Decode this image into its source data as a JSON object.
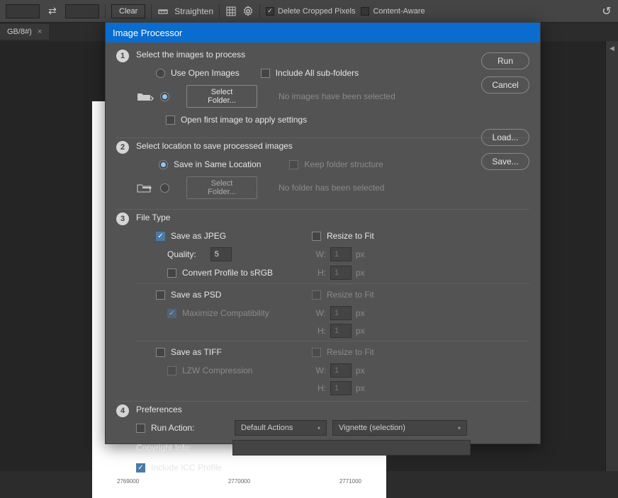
{
  "bgToolbar": {
    "clearBtn": "Clear",
    "straighten": "Straighten",
    "deleteCropped": "Delete Cropped Pixels",
    "contentAware": "Content-Aware"
  },
  "tab": {
    "label": "GB/8#)",
    "close": "×"
  },
  "rulers": [
    "2769000",
    "2770000",
    "2771000"
  ],
  "dialog": {
    "title": "Image Processor",
    "buttons": {
      "run": "Run",
      "cancel": "Cancel",
      "load": "Load...",
      "save": "Save..."
    },
    "s1": {
      "num": "1",
      "title": "Select the images to process",
      "useOpen": "Use Open Images",
      "includeSub": "Include All sub-folders",
      "selectFolder": "Select Folder...",
      "noImages": "No images have been selected",
      "openFirst": "Open first image to apply settings"
    },
    "s2": {
      "num": "2",
      "title": "Select location to save processed images",
      "sameLoc": "Save in Same Location",
      "keepStruct": "Keep folder structure",
      "selectFolder": "Select Folder...",
      "noFolder": "No folder has been selected"
    },
    "s3": {
      "num": "3",
      "title": "File Type",
      "jpeg": "Save as JPEG",
      "quality": "Quality:",
      "qualityVal": "5",
      "convert": "Convert Profile to sRGB",
      "resize": "Resize to Fit",
      "w": "W:",
      "h": "H:",
      "unit": "px",
      "psd": "Save as PSD",
      "maxCompat": "Maximize Compatibility",
      "tiff": "Save as TIFF",
      "lzw": "LZW Compression",
      "one": "1"
    },
    "s4": {
      "num": "4",
      "title": "Preferences",
      "runAction": "Run Action:",
      "defaultActions": "Default Actions",
      "vignette": "Vignette (selection)",
      "copyright": "Copyright Info:",
      "includeICC": "Include ICC Profile"
    }
  }
}
